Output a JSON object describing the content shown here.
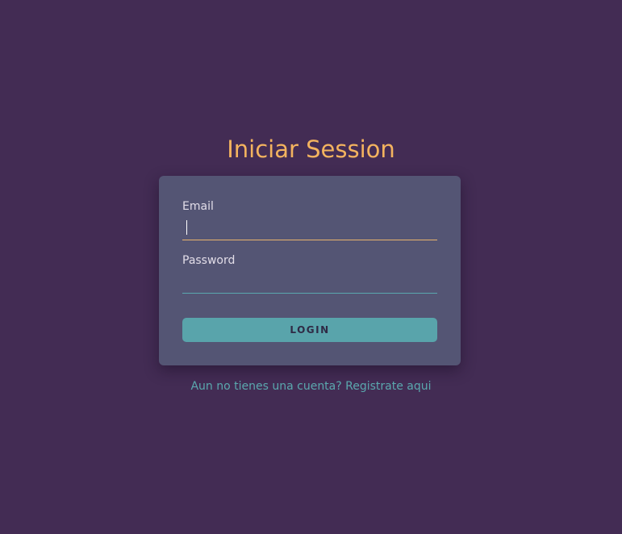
{
  "page": {
    "title": "Iniciar Session"
  },
  "form": {
    "email_label": "Email",
    "email_value": "",
    "password_label": "Password",
    "password_value": "",
    "login_label": "LOGIN"
  },
  "footer": {
    "register_link": "Aun no tienes una cuenta? Registrate aqui"
  },
  "colors": {
    "background": "#432c54",
    "card": "#545574",
    "title": "#f3b35f",
    "accent": "#59a4ab",
    "focused_underline": "#e9b36c"
  }
}
